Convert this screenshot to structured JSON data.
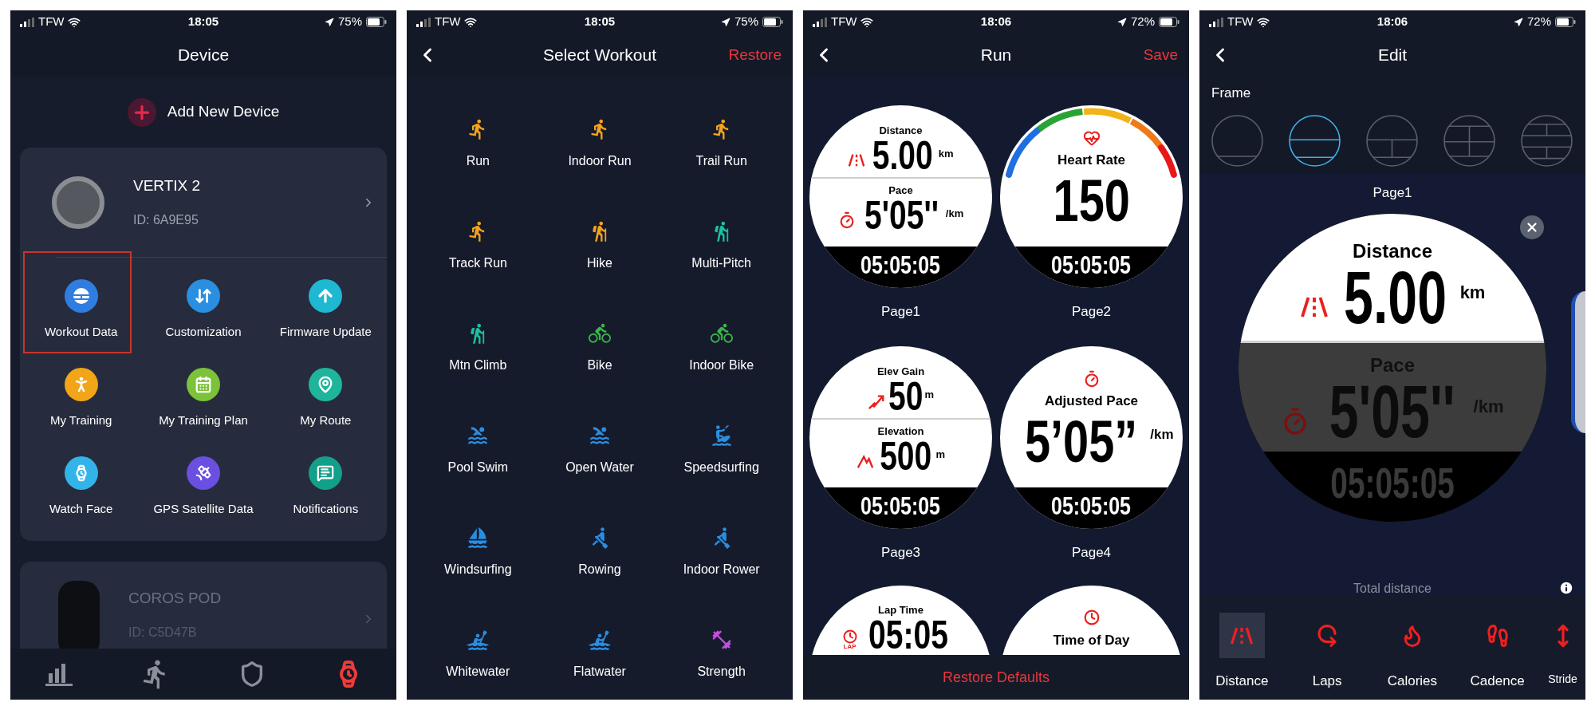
{
  "device_screen": {
    "status_bar": {
      "carrier": "TFW",
      "time": "18:05",
      "battery": "75%"
    },
    "title": "Device",
    "add_device": "Add New Device",
    "devices": [
      {
        "name": "VERTIX 2",
        "id": "ID: 6A9E95",
        "disabled": false
      },
      {
        "name": "COROS POD",
        "id": "ID: C5D47B",
        "disabled": true
      }
    ],
    "features": [
      {
        "label": "Workout Data",
        "color": "#2f7de1",
        "annotated": true
      },
      {
        "label": "Customization",
        "color": "#2a8fe0",
        "annotated": false
      },
      {
        "label": "Firmware Update",
        "color": "#1fb8d3",
        "annotated": false
      },
      {
        "label": "My Training",
        "color": "#f2a516",
        "annotated": false
      },
      {
        "label": "My Training Plan",
        "color": "#7cc23a",
        "annotated": false
      },
      {
        "label": "My Route",
        "color": "#1fb59d",
        "annotated": false
      },
      {
        "label": "Watch Face",
        "color": "#33b4e8",
        "annotated": false
      },
      {
        "label": "GPS Satellite Data",
        "color": "#6a4fe0",
        "annotated": false
      },
      {
        "label": "Notifications",
        "color": "#12a08a",
        "annotated": false
      }
    ],
    "tab_bar": [
      {
        "selected": false
      },
      {
        "selected": false
      },
      {
        "selected": false
      },
      {
        "selected": true
      }
    ]
  },
  "select_workout_screen": {
    "status_bar": {
      "carrier": "TFW",
      "time": "18:05",
      "battery": "75%"
    },
    "title": "Select Workout",
    "action": "Restore",
    "workouts": [
      {
        "label": "Run",
        "color": "#f5a31a"
      },
      {
        "label": "Indoor Run",
        "color": "#f5a31a"
      },
      {
        "label": "Trail Run",
        "color": "#f5a31a"
      },
      {
        "label": "Track Run",
        "color": "#f5a31a"
      },
      {
        "label": "Hike",
        "color": "#f5a31a"
      },
      {
        "label": "Multi-Pitch",
        "color": "#19c2a0"
      },
      {
        "label": "Mtn Climb",
        "color": "#19c2a0"
      },
      {
        "label": "Bike",
        "color": "#3bb54a"
      },
      {
        "label": "Indoor Bike",
        "color": "#3bb54a"
      },
      {
        "label": "Pool Swim",
        "color": "#2a8ee0"
      },
      {
        "label": "Open Water",
        "color": "#2a8ee0"
      },
      {
        "label": "Speedsurfing",
        "color": "#2a8ee0"
      },
      {
        "label": "Windsurfing",
        "color": "#2a8ee0"
      },
      {
        "label": "Rowing",
        "color": "#2a8ee0"
      },
      {
        "label": "Indoor Rower",
        "color": "#2a8ee0"
      },
      {
        "label": "Whitewater",
        "color": "#2a8ee0"
      },
      {
        "label": "Flatwater",
        "color": "#2a8ee0"
      },
      {
        "label": "Strength",
        "color": "#c24fe0"
      }
    ]
  },
  "run_screen": {
    "status_bar": {
      "carrier": "TFW",
      "time": "18:06",
      "battery": "72%"
    },
    "title": "Run",
    "action": "Save",
    "pages": [
      {
        "kind": "two_field",
        "label": "Page1",
        "footer": "05:05:05",
        "fields": [
          {
            "kind": "distance",
            "label": "Distance",
            "value": "5.00",
            "unit": "km"
          },
          {
            "kind": "pace",
            "label": "Pace",
            "value": "5'05''",
            "unit": "/km"
          }
        ]
      },
      {
        "kind": "single",
        "label": "Page2",
        "footer": "05:05:05",
        "zone_arc": true,
        "fields": [
          {
            "kind": "heart_rate",
            "label": "Heart Rate",
            "value": "150"
          }
        ]
      },
      {
        "kind": "two_field",
        "label": "Page3",
        "footer": "05:05:05",
        "fields": [
          {
            "kind": "elev_gain",
            "label": "Elev Gain",
            "value": "50",
            "unit": "m"
          },
          {
            "kind": "elevation",
            "label": "Elevation",
            "value": "500",
            "unit": "m"
          }
        ]
      },
      {
        "kind": "single",
        "label": "Page4",
        "footer": "05:05:05",
        "zone_arc": false,
        "fields": [
          {
            "kind": "adjusted_pace",
            "label": "Adjusted Pace",
            "value": "5’05”",
            "unit": "/km"
          }
        ]
      },
      {
        "kind": "partial",
        "fields": [
          {
            "kind": "lap_time",
            "label": "Lap Time",
            "value": "05:05",
            "badge": "LAP"
          }
        ]
      },
      {
        "kind": "partial",
        "fields": [
          {
            "kind": "time_of_day",
            "label": "Time of Day"
          }
        ]
      }
    ],
    "restore_button": "Restore Defaults"
  },
  "edit_screen": {
    "status_bar": {
      "carrier": "TFW",
      "time": "18:06",
      "battery": "72%"
    },
    "title": "Edit",
    "frame_label": "Frame",
    "frames": [
      {
        "kind": "one",
        "selected": false
      },
      {
        "kind": "two",
        "selected": true
      },
      {
        "kind": "three",
        "selected": false
      },
      {
        "kind": "four",
        "selected": false
      },
      {
        "kind": "five",
        "selected": false
      }
    ],
    "page_label": "Page1",
    "preview": {
      "footer": "05:05:05",
      "fields": [
        {
          "kind": "distance",
          "label": "Distance",
          "value": "5.00",
          "unit": "km",
          "selected": true
        },
        {
          "kind": "pace",
          "label": "Pace",
          "value": "5'05''",
          "unit": "/km",
          "selected": false
        }
      ]
    },
    "description": "Total distance",
    "data_fields": [
      {
        "kind": "distance",
        "label": "Distance",
        "selected": true
      },
      {
        "kind": "laps",
        "label": "Laps",
        "selected": false
      },
      {
        "kind": "calories",
        "label": "Calories",
        "selected": false
      },
      {
        "kind": "cadence",
        "label": "Cadence",
        "selected": false
      },
      {
        "kind": "stride",
        "label": "Stride",
        "selected": false
      }
    ]
  }
}
